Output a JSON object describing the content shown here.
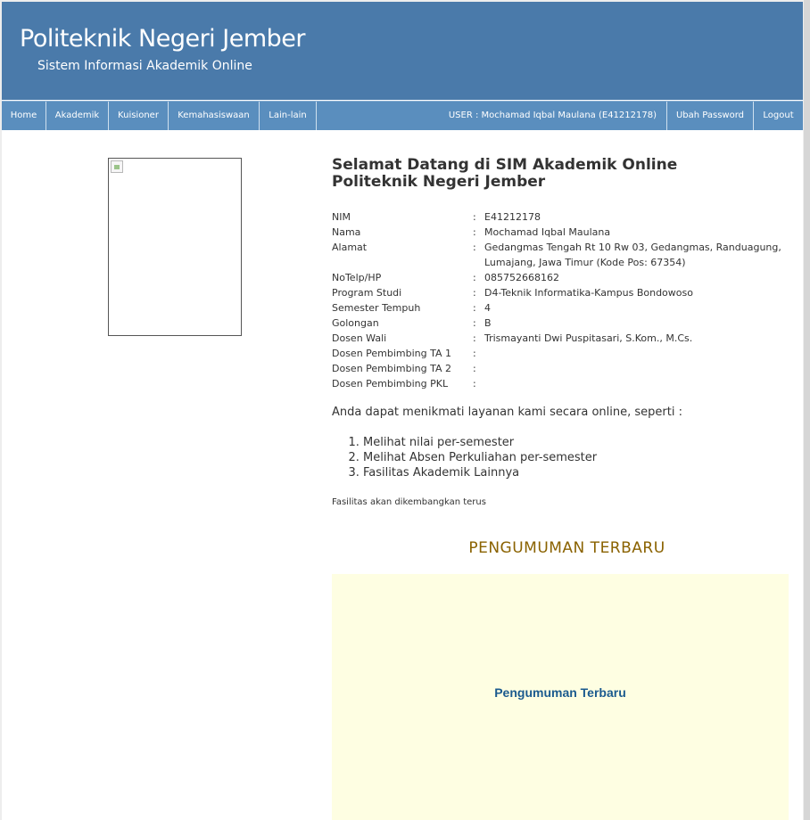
{
  "header": {
    "title": "Politeknik Negeri Jember",
    "subtitle": "Sistem Informasi Akademik Online"
  },
  "nav": {
    "items": [
      {
        "label": "Home"
      },
      {
        "label": "Akademik"
      },
      {
        "label": "Kuisioner"
      },
      {
        "label": "Kemahasiswaan"
      },
      {
        "label": "Lain-lain"
      }
    ],
    "user_label": "USER : Mochamad Iqbal Maulana (E41212178)",
    "change_password": "Ubah Password",
    "logout": "Logout"
  },
  "welcome": {
    "line1": "Selamat Datang di SIM Akademik Online",
    "line2": "Politeknik Negeri Jember"
  },
  "student": {
    "separator": ":",
    "rows": [
      {
        "label": "NIM",
        "value": "E41212178"
      },
      {
        "label": "Nama",
        "value": "Mochamad Iqbal Maulana"
      },
      {
        "label": "Alamat",
        "value": "Gedangmas Tengah Rt 10 Rw 03, Gedangmas, Randuagung, Lumajang, Jawa Timur (Kode Pos: 67354)"
      },
      {
        "label": "NoTelp/HP",
        "value": "085752668162"
      },
      {
        "label": "Program Studi",
        "value": "D4-Teknik Informatika-Kampus Bondowoso"
      },
      {
        "label": "Semester Tempuh",
        "value": "4"
      },
      {
        "label": "Golongan",
        "value": "B"
      },
      {
        "label": "Dosen Wali",
        "value": "Trismayanti Dwi Puspitasari, S.Kom., M.Cs."
      },
      {
        "label": "Dosen Pembimbing TA 1",
        "value": ""
      },
      {
        "label": "Dosen Pembimbing TA 2",
        "value": ""
      },
      {
        "label": "Dosen Pembimbing PKL",
        "value": ""
      }
    ]
  },
  "services": {
    "intro": "Anda dapat menikmati layanan kami secara online, seperti :",
    "items": [
      "Melihat nilai per-semester",
      "Melihat Absen Perkuliahan per-semester",
      "Fasilitas Akademik Lainnya"
    ],
    "note": "Fasilitas akan dikembangkan terus"
  },
  "announcements": {
    "heading": "PENGUMUMAN TERBARU",
    "box_text": "Pengumuman Terbaru"
  },
  "colors": {
    "header_bg": "#4a7aaa",
    "nav_bg": "#5a8ebe",
    "announcement_heading": "#8a6200",
    "announcement_box": "#fefee2",
    "announcement_text": "#1b5a8e"
  },
  "icons": {
    "photo": "broken-image-icon"
  }
}
